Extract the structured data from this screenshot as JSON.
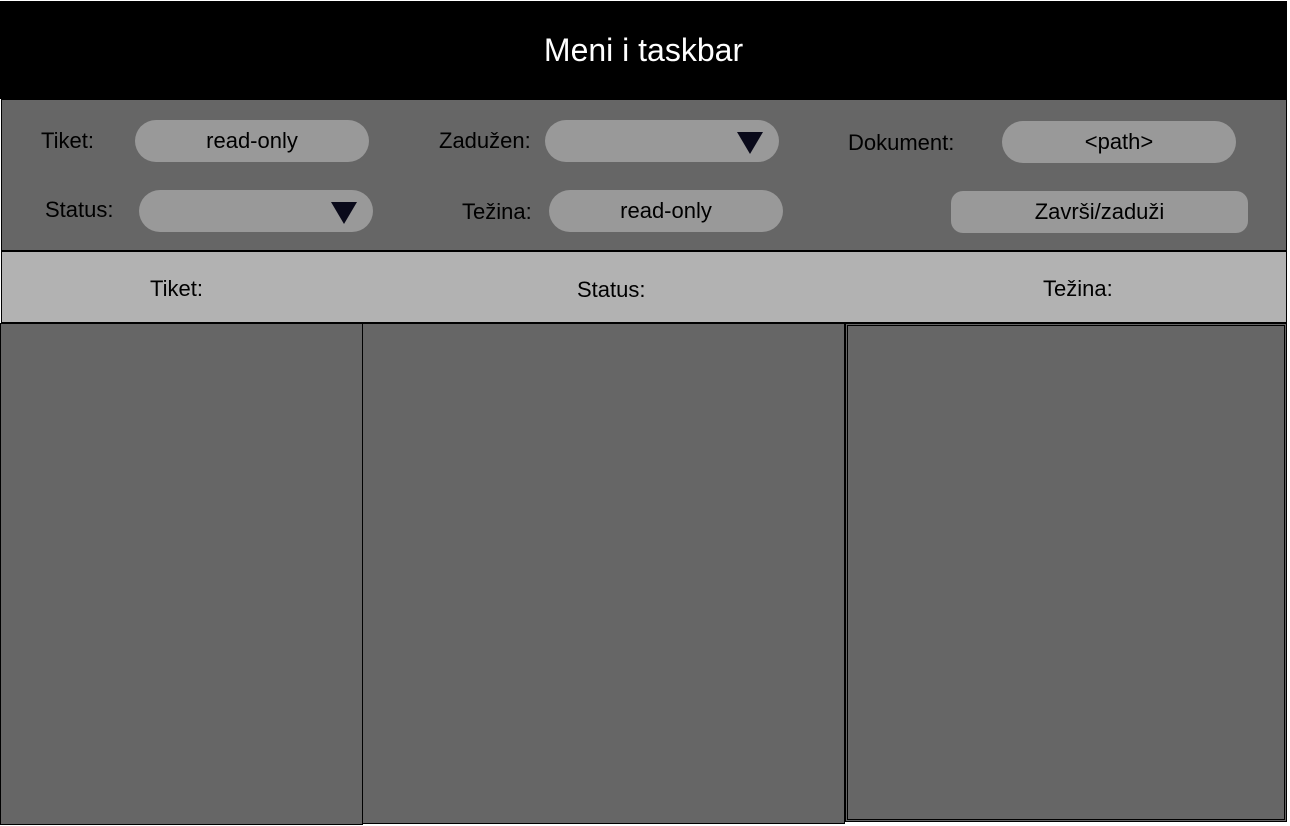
{
  "header": {
    "title": "Meni i taskbar"
  },
  "form": {
    "ticket_label": "Tiket:",
    "ticket_value": "read-only",
    "assigned_label": "Zadužen:",
    "assigned_value": "",
    "document_label": "Dokument:",
    "document_value": "<path>",
    "status_label": "Status:",
    "status_value": "",
    "weight_label": "Težina:",
    "weight_value": "read-only",
    "finish_assign_button": "Završi/zaduži"
  },
  "table": {
    "columns": [
      "Tiket:",
      "Status:",
      "Težina:"
    ]
  },
  "colors": {
    "title_bar": "#000000",
    "panel": "#666666",
    "field": "#999999",
    "header_row": "#b2b2b2"
  },
  "icons": {
    "dropdown": "triangle-down-icon"
  }
}
